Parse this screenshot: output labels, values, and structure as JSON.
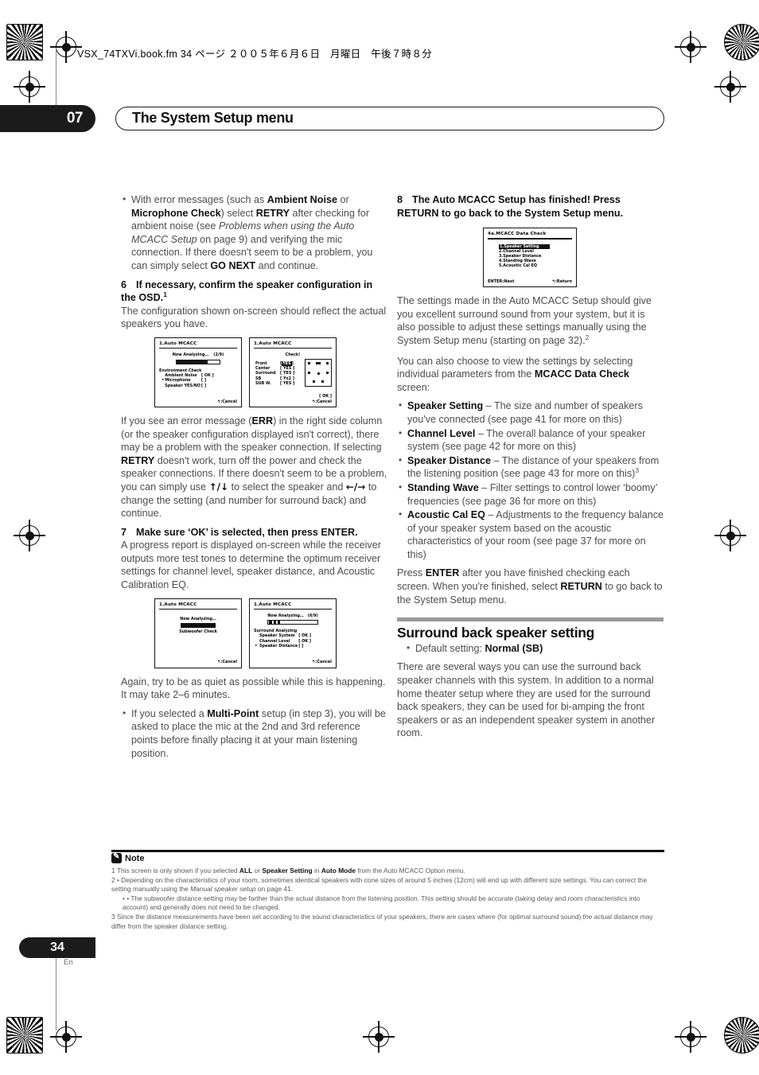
{
  "header": {
    "file_info": "VSX_74TXVi.book.fm  34 ページ  ２００５年６月６日　月曜日　午後７時８分"
  },
  "chapter": {
    "number": "07",
    "title": "The System Setup menu"
  },
  "left_column": {
    "bullet_error": {
      "text_1": "With error messages (such as ",
      "bold_1": "Ambient Noise",
      "text_2": " or ",
      "bold_2": "Microphone Check",
      "text_3": ") select ",
      "bold_3": "RETRY",
      "text_4": " after checking for ambient noise (see ",
      "italic_1": "Problems when using the Auto MCACC Setup",
      "text_5": " on page 9) and verifying the mic connection. If there doesn't seem to be a problem, you can simply select ",
      "bold_4": "GO NEXT",
      "text_6": " and continue."
    },
    "step6": {
      "num": "6",
      "title": "If necessary, confirm the speaker configuration in the OSD.",
      "footnote_ref": "1",
      "body": "The configuration shown on-screen should reflect the actual speakers you have."
    },
    "osd_1": {
      "title": "1.Auto  MCACC",
      "line1": "Now  Analyzing…",
      "counter": "(2/9)",
      "section": "Environment  Check",
      "rows": [
        {
          "label": "Ambient  Noise",
          "value": "[ OK ]",
          "marker": ""
        },
        {
          "label": "Microphone",
          "value": "[     ]",
          "marker": "▸"
        },
        {
          "label": "Speaker  YES/NO",
          "value": "[     ]",
          "marker": ""
        }
      ],
      "footer": "↰:Cancel"
    },
    "osd_2": {
      "title": "1.Auto  MCACC",
      "line1": "Check!",
      "rows": [
        {
          "label": "Front",
          "value": "YES",
          "highlight": true
        },
        {
          "label": "Center",
          "value": "YES",
          "highlight": false
        },
        {
          "label": "Surround",
          "value": "YES",
          "highlight": false
        },
        {
          "label": "SB",
          "value": "Yx2",
          "highlight": false
        },
        {
          "label": "SUB W.",
          "value": "YES",
          "highlight": false
        }
      ],
      "ok": "[ OK ]",
      "footer": "↰:Cancel"
    },
    "para_err": {
      "text_1": "If you see an error message (",
      "bold_1": "ERR",
      "text_2": ") in the right side column (or the speaker configuration displayed isn't correct), there may be a problem with the speaker connection. If selecting ",
      "bold_2": "RETRY",
      "text_3": " doesn't work, turn off the power and check the speaker connections. If there doesn't seem to be a problem, you can simply use ",
      "glyph_1": "↑/↓",
      "text_4": " to select the speaker and ",
      "glyph_2": "←/→",
      "text_5": " to change the setting (and number for surround back) and continue."
    },
    "step7": {
      "num": "7",
      "title": "Make sure ‘OK’ is selected, then press ENTER.",
      "body": "A progress report is displayed on-screen while the receiver outputs more test tones to determine the optimum receiver settings for channel level, speaker distance, and Acoustic Calibration EQ."
    },
    "osd_3": {
      "title": "1.Auto  MCACC",
      "line1": "Now  Analyzing…",
      "line2": "Subwoofer  Check",
      "footer": "↰:Cancel"
    },
    "osd_4": {
      "title": "1.Auto  MCACC",
      "line1": "Now  Analyzing…",
      "counter": "(6/9)",
      "section": "Surround  Analyzing",
      "rows": [
        {
          "label": "Speaker  System",
          "value": "[ OK ]",
          "marker": ""
        },
        {
          "label": "Channel  Level",
          "value": "[ OK ]",
          "marker": ""
        },
        {
          "label": "Speaker  Distance",
          "value": "[     ]",
          "marker": "▸"
        }
      ],
      "footer": "↰:Cancel"
    },
    "para_quiet": "Again, try to be as quiet as possible while this is happening. It may take 2–6 minutes.",
    "bullet_multipoint": {
      "text_1": "If you selected a ",
      "bold_1": "Multi-Point",
      "text_2": " setup (in step 3), you will be asked to place the mic at the 2nd and 3rd reference points before finally placing it at your main listening position."
    }
  },
  "right_column": {
    "step8": {
      "num": "8",
      "title": "The Auto MCACC Setup has finished! Press RETURN to go back to the System Setup menu."
    },
    "osd_5": {
      "title": "4a.MCACC  Data  Check",
      "items": [
        {
          "label": "1.Speaker  Setting",
          "highlight": true
        },
        {
          "label": "2.Channel  Level",
          "highlight": false
        },
        {
          "label": "3.Speaker  Distance",
          "highlight": false
        },
        {
          "label": "4.Standing  Wave",
          "highlight": false
        },
        {
          "label": "5.Acoustic  Cal  EQ",
          "highlight": false
        }
      ],
      "footer_left": "ENTER:Next",
      "footer_right": "↰:Return"
    },
    "para_settings": {
      "text_1": "The settings made in the Auto MCACC Setup should give you excellent surround sound from your system, but it is also possible to adjust these settings manually using the System Setup menu (starting on page 32).",
      "footnote_ref": "2"
    },
    "para_view": {
      "text_1": "You can also choose to view the settings by selecting individual parameters from the ",
      "bold_1": "MCACC Data Check",
      "text_2": " screen:"
    },
    "params": [
      {
        "name": "Speaker Setting",
        "desc": " – The size and number of speakers you've connected (see page 41 for more on this)",
        "footnote_ref": ""
      },
      {
        "name": "Channel Level",
        "desc": " – The overall balance of your speaker system (see page 42 for more on this)",
        "footnote_ref": ""
      },
      {
        "name": "Speaker Distance",
        "desc": " – The distance of your speakers from the listening position (see page 43 for more on this)",
        "footnote_ref": "3"
      },
      {
        "name": "Standing Wave",
        "desc": " – Filter settings to control lower ‘boomy’ frequencies (see page 36 for more on this)",
        "footnote_ref": ""
      },
      {
        "name": "Acoustic Cal EQ",
        "desc": " – Adjustments to the frequency balance of your speaker system based on the acoustic characteristics of your room (see page 37 for more on this)",
        "footnote_ref": ""
      }
    ],
    "para_press": {
      "text_1": "Press ",
      "bold_1": "ENTER",
      "text_2": " after you have finished checking each screen. When you're finished, select ",
      "bold_2": "RETURN",
      "text_3": " to go back to the System Setup menu."
    },
    "section": {
      "heading": "Surround back speaker setting",
      "default_label": "Default setting: ",
      "default_value": "Normal (SB)",
      "body": "There are several ways you can use the surround back speaker channels with this system. In addition to a normal home theater setup where they are used for the surround back speakers, they can be used for bi-amping the front speakers or as an independent speaker system in another room."
    }
  },
  "notes": {
    "heading": "Note",
    "note1": {
      "text_1": "1 This screen is only shown if you selected ",
      "bold_1": "ALL",
      "text_2": " or ",
      "bold_2": "Speaker Setting",
      "text_3": " in ",
      "bold_3": "Auto Mode",
      "text_4": " from the Auto MCACC Option menu."
    },
    "note2a": {
      "text_1": "2 • Depending on the characteristics of your room, sometimes identical speakers with cone sizes of around 5 inches (12cm) will end up with different size settings. You can correct the setting manually using the ",
      "italic_1": "Manual speaker setup",
      "text_2": " on page 41."
    },
    "note2b": "• The subwoofer distance setting may be farther than the actual distance from the listening position. This setting should be accurate (taking delay and room characteristics into account) and generally does not need to be changed.",
    "note3": "3 Since the distance measurements have been set according to the sound characteristics of your speakers, there are cases where (for optimal surround sound) the actual distance may differ from the speaker distance setting."
  },
  "footer": {
    "page_number": "34",
    "language": "En"
  }
}
